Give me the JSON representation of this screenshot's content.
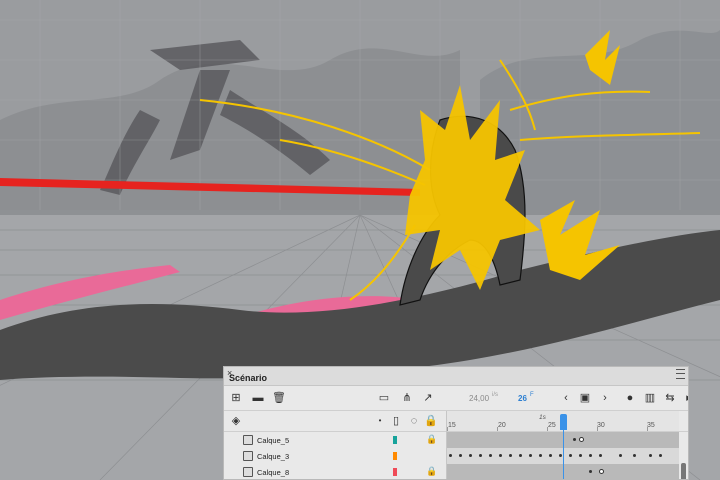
{
  "canvas": {
    "background_color": "#8a8d91",
    "accent_red": "#e6231f",
    "accent_pink": "#e96a98",
    "accent_yellow": "#f5c400",
    "shadow_gray": "#4b4b4b"
  },
  "panel": {
    "close_label": "×",
    "title": "Scénario",
    "toolbar": {
      "new_layer_icon": "new-layer-icon",
      "folder_icon": "folder-icon",
      "trash_icon": "trash-icon",
      "camera_icon": "camera-icon",
      "parenting_icon": "parenting-icon",
      "graph_icon": "graph-icon",
      "fps_value": "24,00",
      "fps_unit": "i/s",
      "current_frame": "26",
      "frame_unit": "F",
      "prev_icon": "chevron-left-icon",
      "loop_icon": "loop-icon",
      "next_icon": "chevron-right-icon",
      "onion_icon": "onion-skin-icon",
      "edit_icon": "edit-multiple-icon",
      "more_icon": "arrow-right-icon"
    },
    "ruler": {
      "seconds_label": "1s",
      "frames": [
        "15",
        "20",
        "25",
        "30",
        "35"
      ]
    },
    "layers": [
      {
        "name": "Calque_5",
        "color": "#17a39b",
        "locked": true
      },
      {
        "name": "Calque_3",
        "color": "#ff8a00",
        "locked": false
      },
      {
        "name": "Calque_8",
        "color": "#ef4a57",
        "locked": true
      }
    ]
  }
}
